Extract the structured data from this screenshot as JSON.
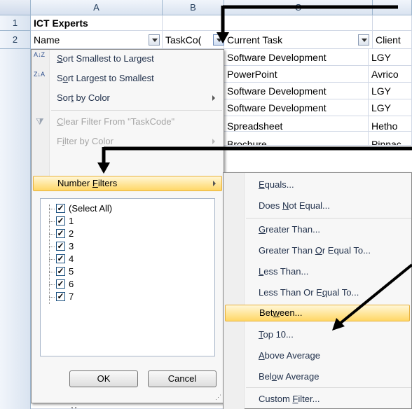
{
  "sheet": {
    "columns": [
      {
        "letter": "A"
      },
      {
        "letter": "B"
      },
      {
        "letter": "C"
      },
      {
        "letter": ""
      }
    ],
    "rows": [
      "1",
      "2"
    ],
    "title": "ICT Experts",
    "headers": {
      "name": "Name",
      "taskcode": "TaskCo(",
      "current_task": "Current Task",
      "client": "Client"
    },
    "visible_data": [
      {
        "task": "Software Development",
        "client": "LGY"
      },
      {
        "task": "PowerPoint",
        "client": "Avrico"
      },
      {
        "task": "Software Development",
        "client": "LGY"
      },
      {
        "task": "Software Development",
        "client": "LGY"
      },
      {
        "task": "Spreadsheet",
        "client": "Hetho"
      },
      {
        "task": "Brochure",
        "client": "Pinnac"
      }
    ],
    "bottom_fragment": "y"
  },
  "filter_menu": {
    "items": [
      {
        "label_pre": "",
        "underline": "S",
        "label_post": "ort Smallest to Largest",
        "icon": "sort-ascending-icon",
        "icon_text": "A↓Z",
        "enabled": true
      },
      {
        "label_pre": "S",
        "underline": "o",
        "label_post": "rt Largest to Smallest",
        "icon": "sort-descending-icon",
        "icon_text": "Z↓A",
        "enabled": true
      },
      {
        "label_pre": "Sor",
        "underline": "t",
        "label_post": " by Color",
        "enabled": true,
        "submenu": true
      },
      {
        "label_pre": "",
        "underline": "C",
        "label_post": "lear Filter From \"TaskCode\"",
        "icon": "clear-filter-icon",
        "enabled": false
      },
      {
        "label_pre": "F",
        "underline": "i",
        "label_post": "lter by Color",
        "enabled": false,
        "submenu": true
      },
      {
        "label_pre": "Number ",
        "underline": "F",
        "label_post": "ilters",
        "enabled": true,
        "submenu": true,
        "highlighted": true
      }
    ],
    "checklist": [
      "(Select All)",
      "1",
      "2",
      "3",
      "4",
      "5",
      "6",
      "7"
    ],
    "ok_label": "OK",
    "cancel_label": "Cancel"
  },
  "number_filters_menu": {
    "items": [
      {
        "pre": "",
        "u": "E",
        "post": "quals..."
      },
      {
        "pre": "Does ",
        "u": "N",
        "post": "ot Equal..."
      },
      {
        "pre": "",
        "u": "G",
        "post": "reater Than..."
      },
      {
        "pre": "Greater Than ",
        "u": "O",
        "post": "r Equal To..."
      },
      {
        "pre": "",
        "u": "L",
        "post": "ess Than..."
      },
      {
        "pre": "Less Than Or E",
        "u": "q",
        "post": "ual To..."
      },
      {
        "pre": "Bet",
        "u": "w",
        "post": "een...",
        "highlighted": true
      },
      {
        "pre": "",
        "u": "T",
        "post": "op 10..."
      },
      {
        "pre": "",
        "u": "A",
        "post": "bove Average"
      },
      {
        "pre": "Bel",
        "u": "o",
        "post": "w Average"
      },
      {
        "pre": "Custom ",
        "u": "F",
        "post": "ilter..."
      }
    ]
  },
  "colors": {
    "highlight": "#ffd766",
    "header": "#d9e3f0",
    "arrow": "#000000"
  }
}
